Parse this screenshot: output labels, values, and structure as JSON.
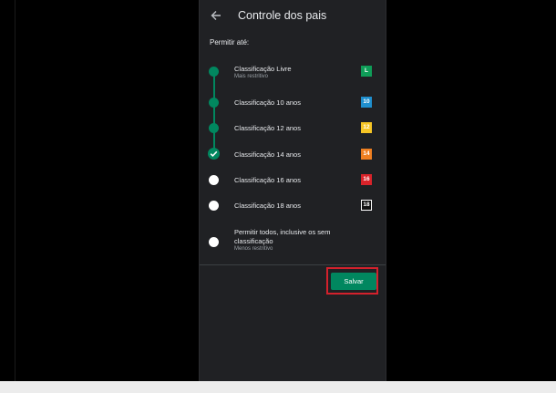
{
  "header": {
    "title": "Controle dos pais"
  },
  "section_label": "Permitir até:",
  "options": [
    {
      "label": "Classificação Livre",
      "sublabel": "Mais restritivo",
      "badge": "L",
      "badge_color": "#0f9d58",
      "state": "filled"
    },
    {
      "label": "Classificação 10 anos",
      "badge": "10",
      "badge_color": "#1f8fce",
      "state": "filled"
    },
    {
      "label": "Classificação 12 anos",
      "badge": "12",
      "badge_color": "#f6c525",
      "state": "filled"
    },
    {
      "label": "Classificação 14 anos",
      "badge": "14",
      "badge_color": "#ef7f21",
      "state": "checked"
    },
    {
      "label": "Classificação 16 anos",
      "badge": "16",
      "badge_color": "#d9232a",
      "state": "empty"
    },
    {
      "label": "Classificação 18 anos",
      "badge": "18",
      "badge_color": "#111111",
      "state": "empty"
    },
    {
      "label_line1": "Permitir todos, inclusive os sem",
      "label_line2": "classificação",
      "sublabel": "Menos restritivo",
      "state": "empty"
    }
  ],
  "save_button": {
    "label": "Salvar"
  },
  "colors": {
    "accent": "#01875f",
    "highlight": "#d3212c",
    "background": "#202124"
  },
  "icons": {
    "back": "arrow-left-icon",
    "check": "checkmark-icon"
  }
}
